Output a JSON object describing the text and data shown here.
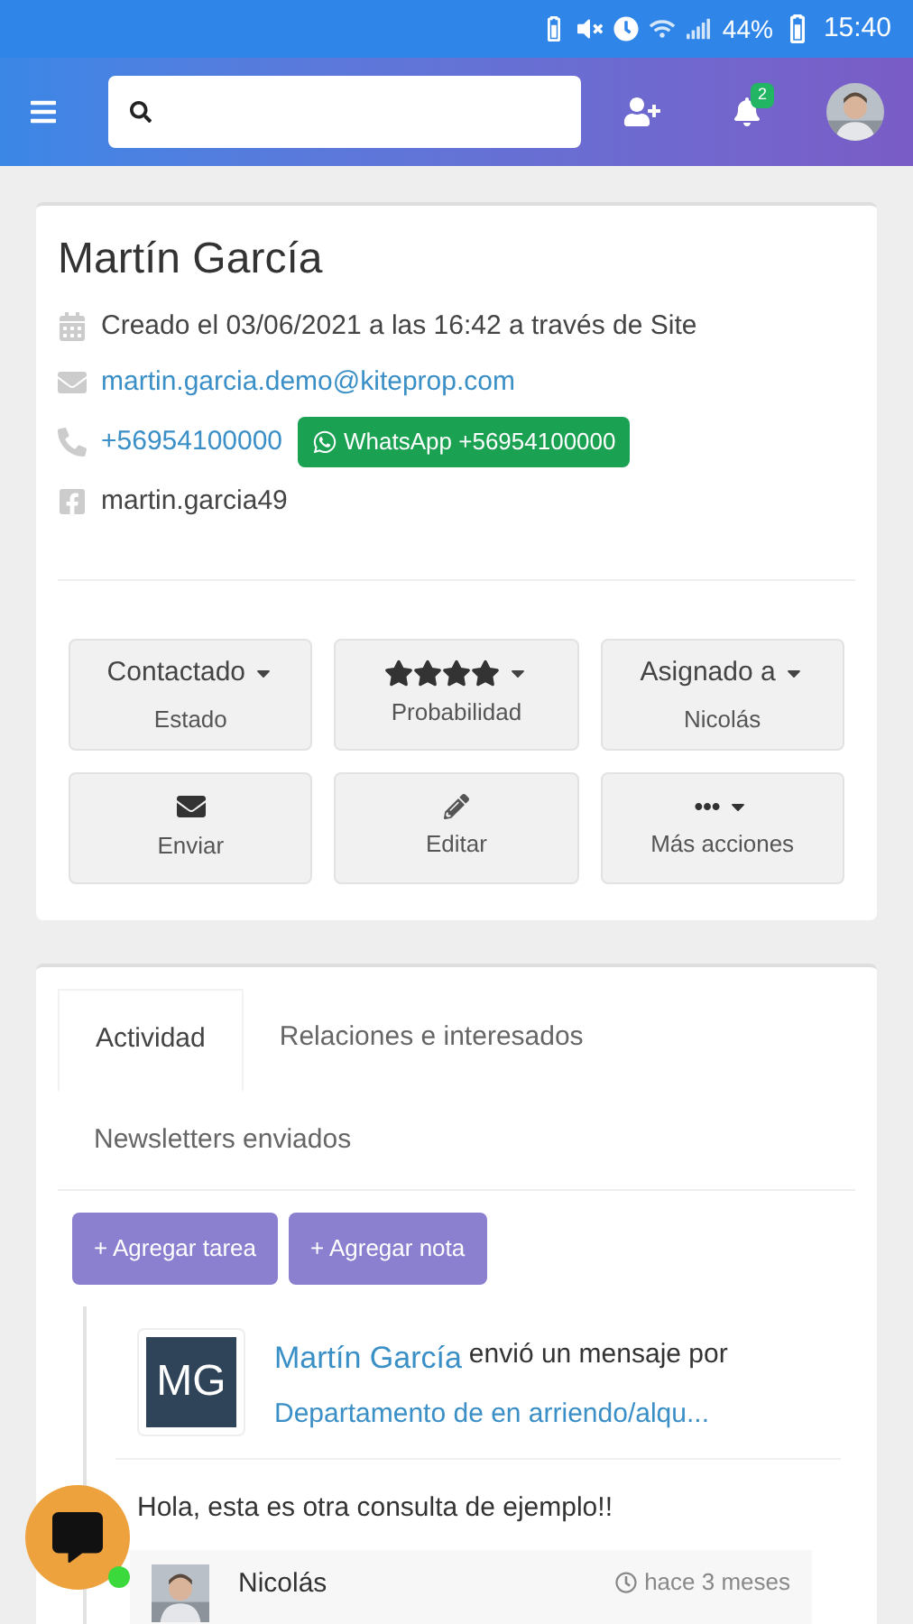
{
  "status_bar": {
    "battery_text": "44%",
    "time": "15:40"
  },
  "header": {
    "notification_count": "2"
  },
  "contact": {
    "name": "Martín García",
    "created": "Creado el 03/06/2021 a las 16:42 a través de Site",
    "email": "martin.garcia.demo@kiteprop.com",
    "phone": "+56954100000",
    "whatsapp": "WhatsApp +56954100000",
    "facebook": "martin.garcia49"
  },
  "actions": [
    {
      "kind": "dropdown",
      "title": "Contactado",
      "subtitle": "Estado"
    },
    {
      "kind": "stars",
      "stars": 4,
      "subtitle": "Probabilidad"
    },
    {
      "kind": "dropdown",
      "title": "Asignado a",
      "subtitle": "Nicolás"
    },
    {
      "kind": "mail",
      "subtitle": "Enviar"
    },
    {
      "kind": "pencil",
      "subtitle": "Editar"
    },
    {
      "kind": "more",
      "subtitle": "Más acciones"
    }
  ],
  "tabs": [
    {
      "label": "Actividad",
      "selected": true
    },
    {
      "label": "Relaciones e interesados",
      "selected": false
    },
    {
      "label": "Newsletters enviados",
      "selected": false
    }
  ],
  "add_buttons": [
    "+ Agregar tarea",
    "+ Agregar nota"
  ],
  "activity": {
    "initials": "MG",
    "author": "Martín García",
    "action": "envió un mensaje por",
    "link": "Departamento de en arriendo/alqu...",
    "message": "Hola, esta es otra consulta de ejemplo!!",
    "reply": {
      "author": "Nicolás",
      "time": "hace 3 meses"
    }
  }
}
